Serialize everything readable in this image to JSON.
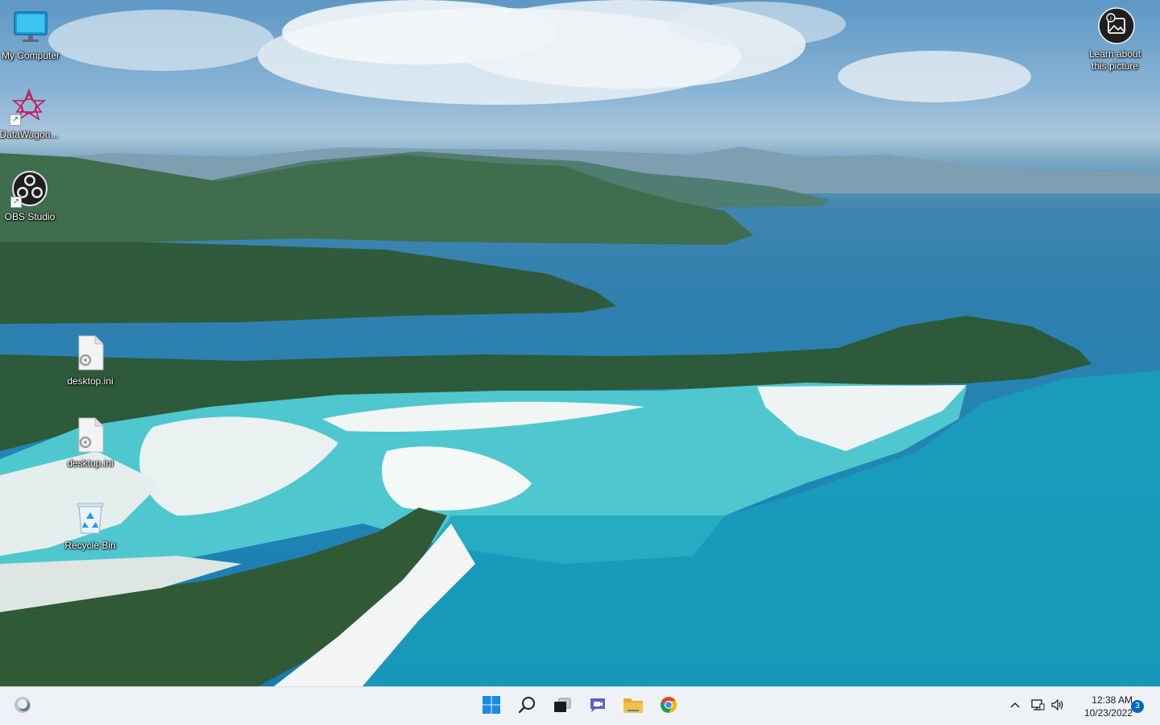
{
  "desktop": {
    "icons": [
      {
        "label": "My Computer",
        "icon": "monitor-icon"
      },
      {
        "label": "DataWagon...",
        "icon": "datawagon-icon"
      },
      {
        "label": "OBS Studio",
        "icon": "obs-icon"
      },
      {
        "label": "desktop.ini",
        "icon": "settings-file-icon"
      },
      {
        "label": "desktop.ini",
        "icon": "settings-file-icon"
      },
      {
        "label": "Recycle Bin",
        "icon": "recycle-bin-icon"
      }
    ],
    "learn_picture": {
      "label": "Learn about this picture",
      "icon": "picture-info-icon"
    }
  },
  "taskbar": {
    "widgets_icon": "weather-widget-icon",
    "apps": [
      {
        "name": "Start",
        "icon": "windows-start-icon"
      },
      {
        "name": "Search",
        "icon": "search-icon"
      },
      {
        "name": "Task View",
        "icon": "task-view-icon"
      },
      {
        "name": "Chat",
        "icon": "chat-icon"
      },
      {
        "name": "File Explorer",
        "icon": "folder-icon"
      },
      {
        "name": "Google Chrome",
        "icon": "chrome-icon"
      }
    ],
    "tray": {
      "overflow_icon": "chevron-up-icon",
      "network_icon": "network-icon",
      "volume_icon": "volume-icon",
      "time": "12:38 AM",
      "date": "10/23/2022",
      "notification_count": "3"
    }
  },
  "colors": {
    "taskbar_bg": "#eef2f6",
    "accent": "#0067c0",
    "start_blue": "#1a8ce0",
    "folder_yellow": "#f5c242"
  }
}
